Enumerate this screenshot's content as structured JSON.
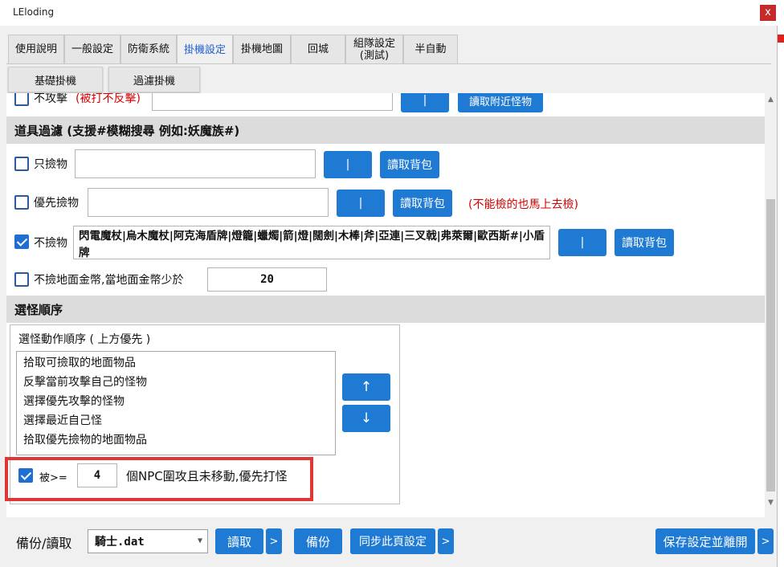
{
  "window": {
    "title": "LEloding",
    "close_label": "x"
  },
  "tabs": [
    {
      "label": "使用說明"
    },
    {
      "label": "一般設定"
    },
    {
      "label": "防衛系統"
    },
    {
      "label": "掛機設定"
    },
    {
      "label": "掛機地圖"
    },
    {
      "label": "回城"
    },
    {
      "label": "組隊設定\n(測試)"
    },
    {
      "label": "半自動"
    }
  ],
  "subtabs": [
    {
      "label": "基礎掛機"
    },
    {
      "label": "過濾掛機"
    }
  ],
  "top_row": {
    "label": "不攻擊",
    "hint": "(被打不反擊)",
    "pipe_label": "|",
    "read_nearby_label": "讀取附近怪物"
  },
  "item_filter": {
    "section_title": "道具過濾 (支援#模糊搜尋 例如:妖魔族#)",
    "only_pickup": {
      "label": "只撿物",
      "checked": false,
      "value": "",
      "pipe_label": "|",
      "read_label": "讀取背包"
    },
    "priority_pickup": {
      "label": "優先撿物",
      "checked": false,
      "value": "",
      "pipe_label": "|",
      "read_label": "讀取背包",
      "note": "(不能檢的也馬上去檢)"
    },
    "no_pickup": {
      "label": "不撿物",
      "checked": true,
      "value": "閃電魔杖|烏木魔杖|阿克海盾牌|燈籠|蠟燭|箭|燈|闊劍|木棒|斧|亞連|三叉戟|弗萊爾|歐西斯#|小盾牌",
      "pipe_label": "|",
      "read_label": "讀取背包"
    },
    "gold_threshold": {
      "label": "不撿地面金幣,當地面金幣少於",
      "checked": false,
      "value": "20"
    }
  },
  "monster_order": {
    "section_title": "選怪順序",
    "group_title": "選怪動作順序 ( 上方優先 )",
    "items": [
      "拾取可撿取的地面物品",
      "反擊當前攻擊自己的怪物",
      "選擇優先攻擊的怪物",
      "選擇最近自己怪",
      "拾取優先撿物的地面物品"
    ],
    "up_label": "↑",
    "down_label": "↓",
    "npc_rule": {
      "prefix": "被>=",
      "value": "4",
      "suffix": "個NPC圍攻且未移動,優先打怪",
      "checked": true
    }
  },
  "footer": {
    "backup_label": "備份/讀取",
    "file_value": "騎士.dat",
    "read_label": "讀取",
    "more": ">",
    "backup_btn_label": "備份",
    "sync_label": "同步此頁設定",
    "save_exit_label": "保存設定並離開"
  },
  "colors": {
    "accent": "#1f7ad4",
    "active_tab": "#1f5fd0",
    "warning": "#d40000",
    "highlight": "#e13636"
  }
}
